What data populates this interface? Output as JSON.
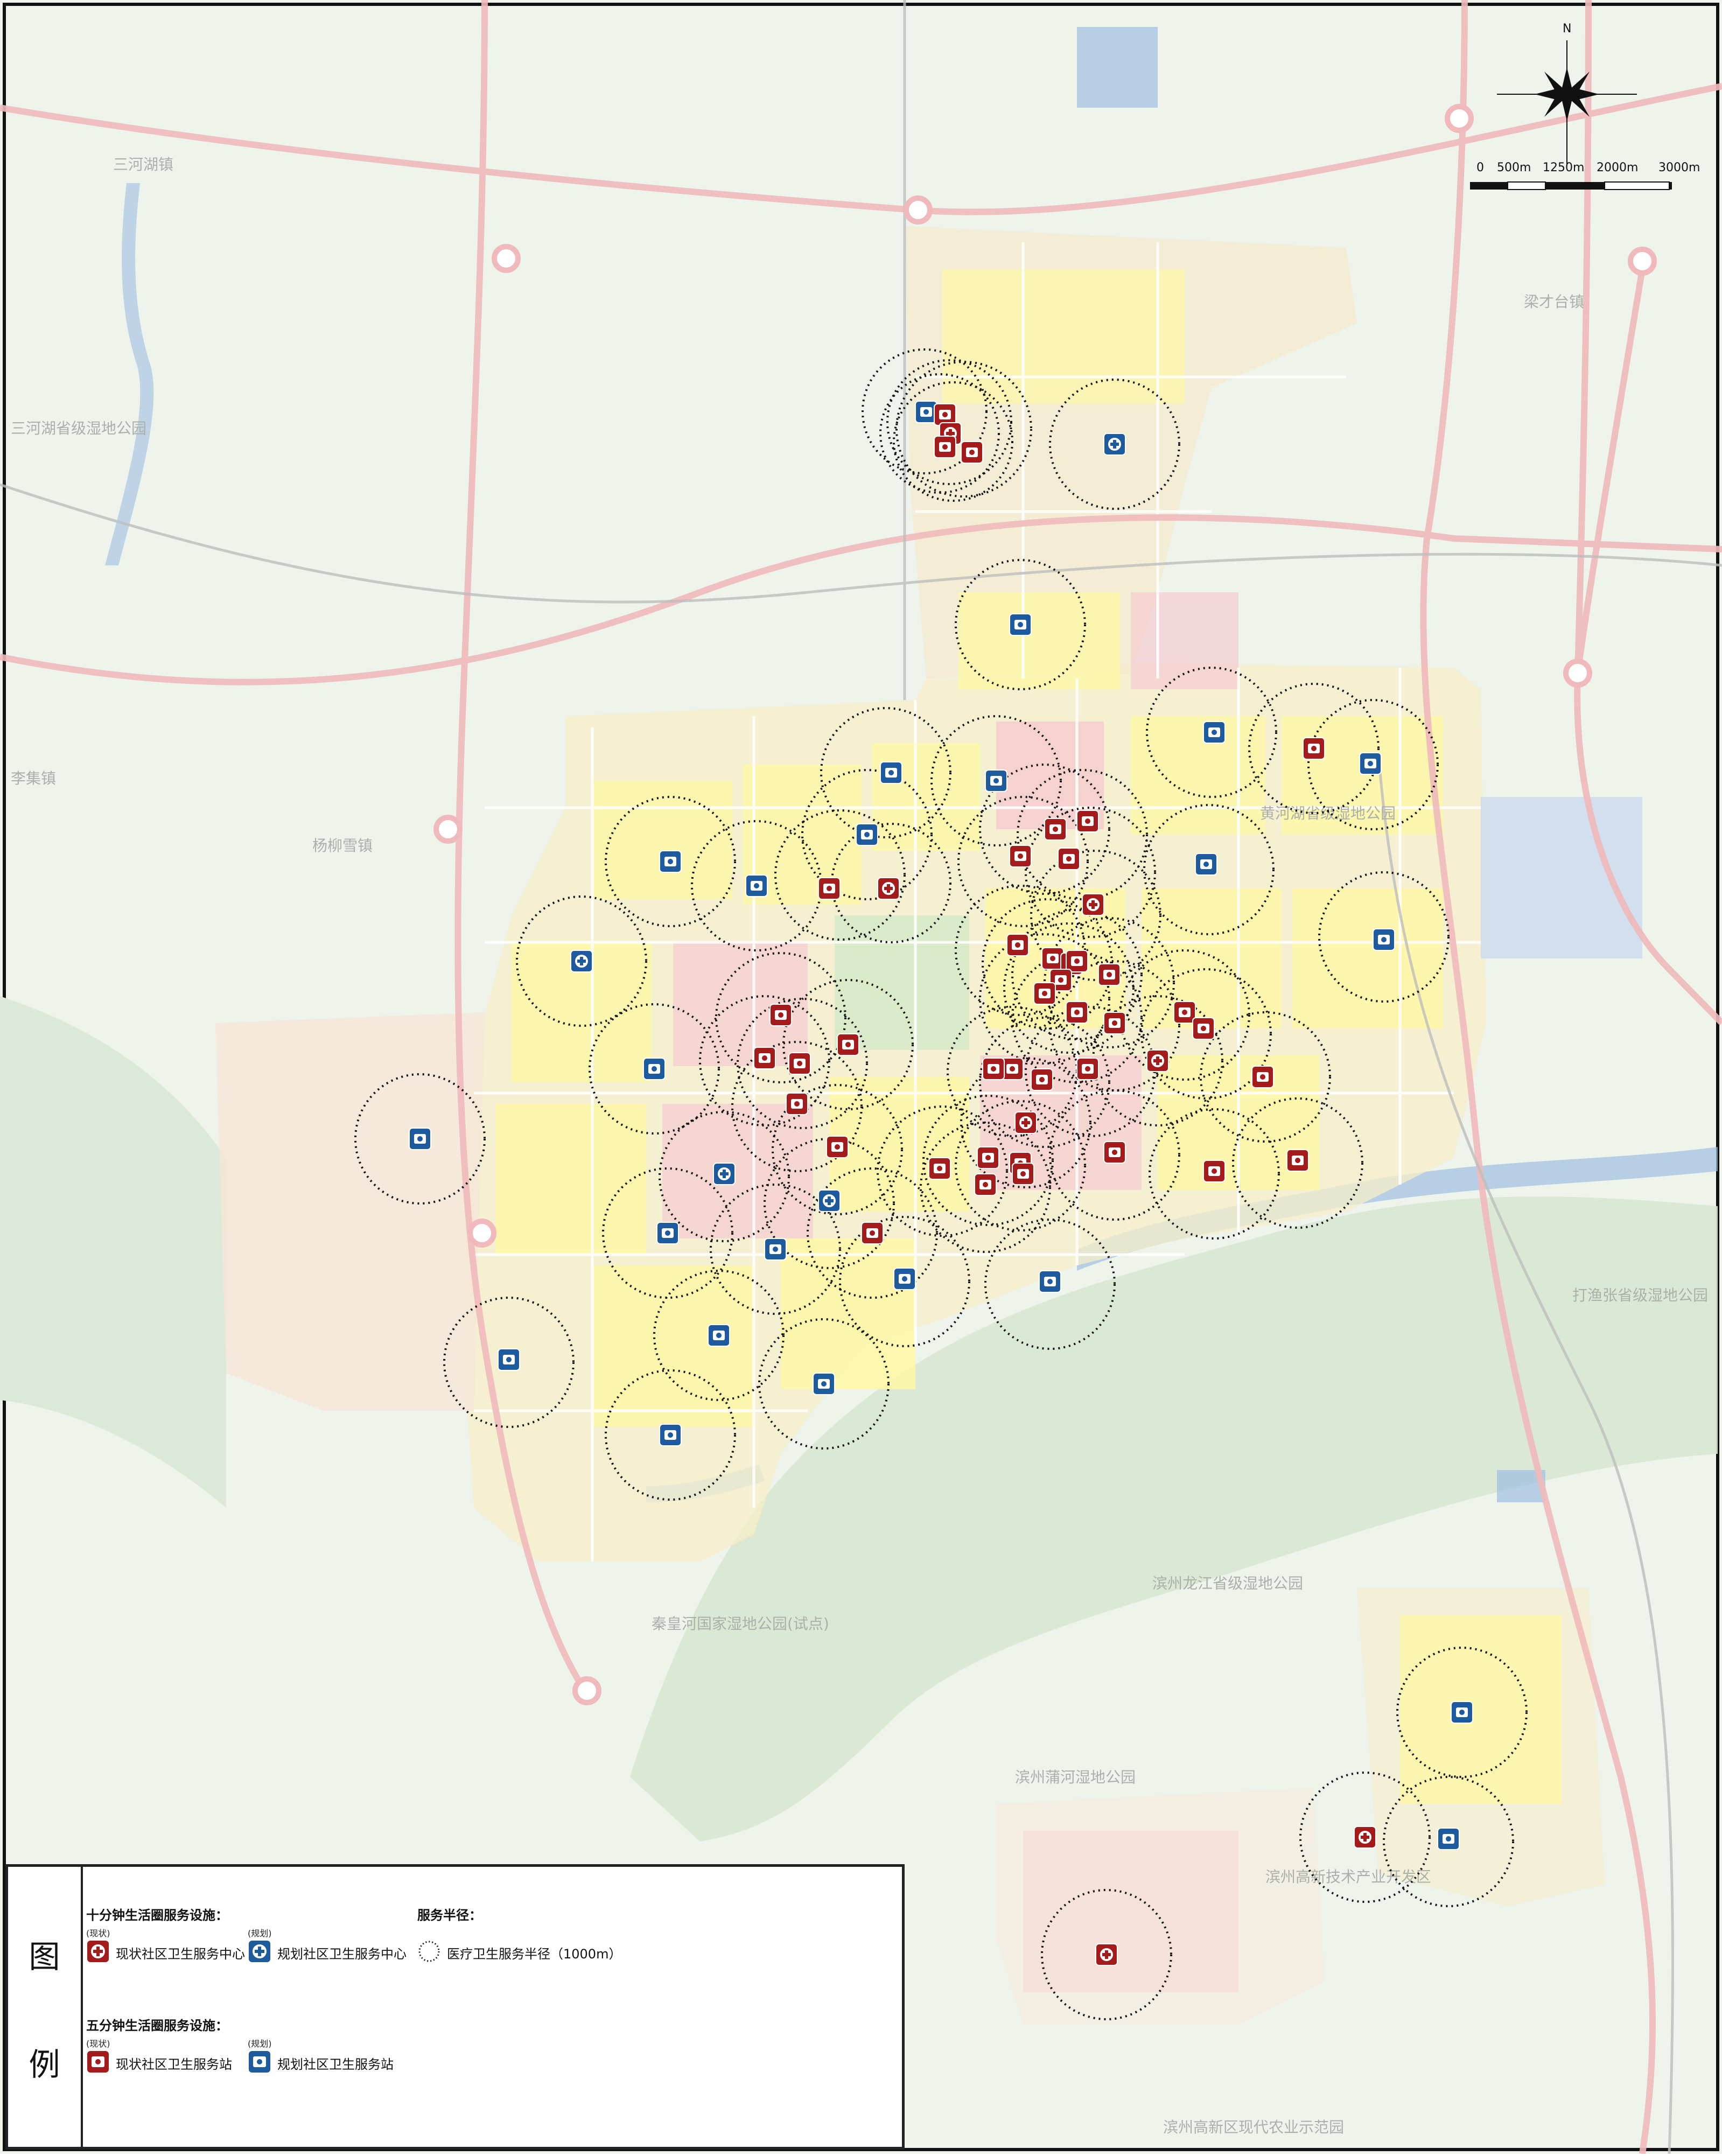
{
  "map": {
    "place_labels": {
      "sanhehu": "三河湖镇",
      "sanhehu_wetland": "三河湖省级湿地公园",
      "yangliuxue": "杨柳雪镇",
      "lisu": "李集镇",
      "qinhuanghe": "秦皇河国家湿地公园(试点)",
      "huanghu": "黄河湖省级湿地公园",
      "longjiang": "滨州龙江省级湿地公园",
      "puhe": "滨州蒲河湿地公园",
      "tech_park": "滨州高新技术产业开发区",
      "agri_park": "滨州高新区现代农业示范园",
      "dagu": "打渔张省级湿地公园",
      "liangcai": "梁才台镇"
    },
    "compass": {
      "north": "N"
    },
    "scale": {
      "ticks": [
        "0",
        "500m",
        "1250m",
        "2000m",
        "3000m"
      ]
    },
    "colors": {
      "existing": "#a31b1b",
      "planned": "#1d5a9e",
      "ring_road": "#f0b9bb",
      "yellow_land": "#fff7a6",
      "pink_land": "#f6c5cf",
      "green_land": "#c9e6c3",
      "water": "#9ebfe2"
    }
  },
  "legend": {
    "title_chars": [
      "图",
      "例"
    ],
    "ten_min": {
      "title": "十分钟生活圈服务设施：",
      "existing_status": "(现状)",
      "existing_label": "现状社区卫生服务中心",
      "planned_status": "(规划)",
      "planned_label": "规划社区卫生服务中心"
    },
    "radius": {
      "title": "服务半径：",
      "label": "医疗卫生服务半径（1000m）"
    },
    "five_min": {
      "title": "五分钟生活圈服务设施：",
      "existing_status": "(现状)",
      "existing_label": "现状社区卫生服务站",
      "planned_status": "(规划)",
      "planned_label": "规划社区卫生服务站"
    },
    "icons": {
      "center_existing": "red-cross-medical-center-icon",
      "center_planned": "blue-cross-medical-center-icon",
      "station_existing": "red-medical-station-icon",
      "station_planned": "blue-medical-station-icon",
      "radius": "dotted-service-radius-icon"
    }
  }
}
